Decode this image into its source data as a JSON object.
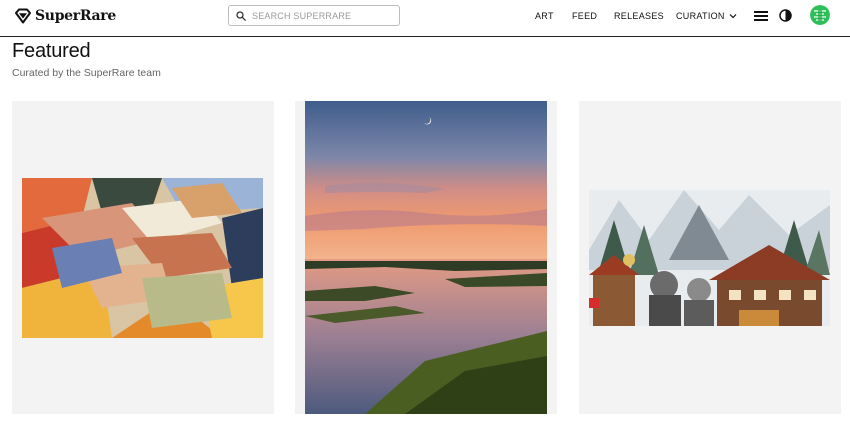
{
  "header": {
    "logo_text": "SuperRare",
    "logo_icon": "diamond-icon",
    "search_placeholder": "SEARCH SUPERRARE",
    "nav": {
      "art": "ART",
      "feed": "FEED",
      "releases": "RELEASES",
      "curation": "CURATION"
    },
    "icons": [
      "search-icon",
      "chevron-down-icon",
      "menu-icon",
      "theme-toggle-icon",
      "avatar"
    ]
  },
  "main": {
    "title": "Featured",
    "subtitle": "Curated by the SuperRare team",
    "cards": [
      {
        "artwork": "hands-illustration"
      },
      {
        "artwork": "sunset-marsh-photo"
      },
      {
        "artwork": "alpine-village-collage"
      }
    ]
  },
  "colors": {
    "card_background": "#f3f3f3",
    "avatar_green": "#2fbf5a",
    "text_primary": "#111111",
    "text_secondary": "#666666"
  }
}
